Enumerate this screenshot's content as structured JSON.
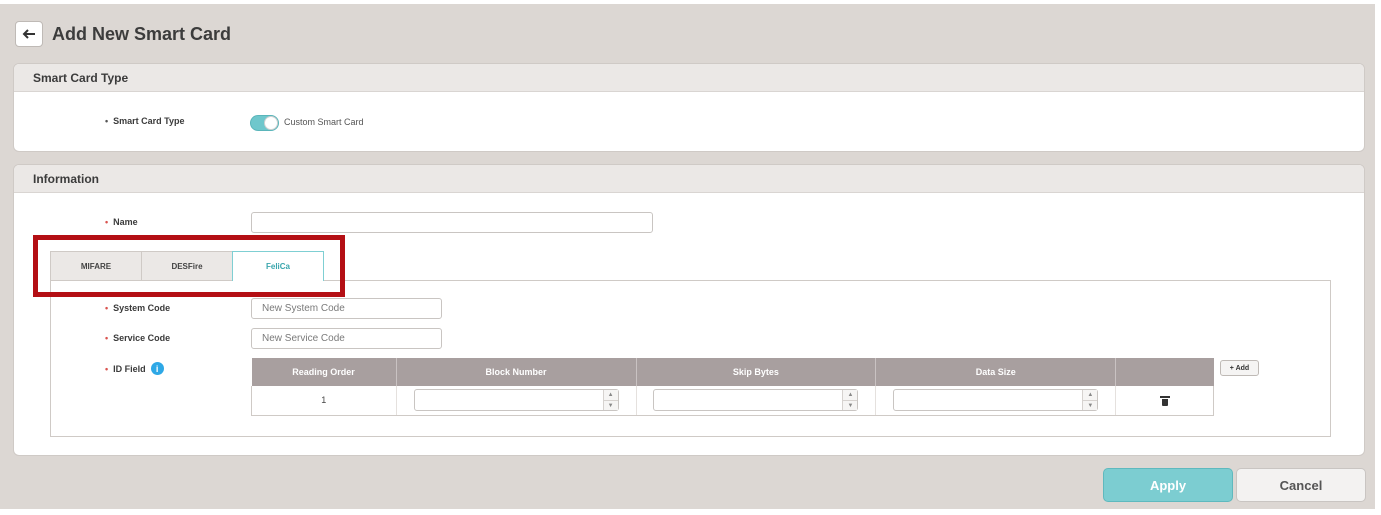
{
  "header": {
    "back_icon": "arrow-left-icon",
    "title": "Add New Smart Card"
  },
  "type_panel": {
    "title": "Smart Card Type",
    "field_label": "Smart Card Type",
    "toggle_label": "Custom Smart Card",
    "toggle_on": true
  },
  "info_panel": {
    "title": "Information",
    "name_label": "Name",
    "name_value": "",
    "tabs": [
      {
        "label": "MIFARE",
        "active": false
      },
      {
        "label": "DESFire",
        "active": false
      },
      {
        "label": "FeliCa",
        "active": true
      }
    ],
    "system_code_label": "System Code",
    "system_code_placeholder": "New System Code",
    "service_code_label": "Service Code",
    "service_code_placeholder": "New Service Code",
    "id_field_label": "ID Field",
    "info_icon_text": "i",
    "table": {
      "headers": [
        "Reading Order",
        "Block Number",
        "Skip Bytes",
        "Data Size",
        ""
      ],
      "rows": [
        {
          "reading_order": "1",
          "block_number": "",
          "skip_bytes": "",
          "data_size": ""
        }
      ]
    },
    "add_label": "+ Add"
  },
  "footer": {
    "apply_label": "Apply",
    "cancel_label": "Cancel"
  },
  "colors": {
    "accent": "#7ccdd1",
    "highlight": "#b40f14",
    "table_header": "#a89f9f"
  }
}
